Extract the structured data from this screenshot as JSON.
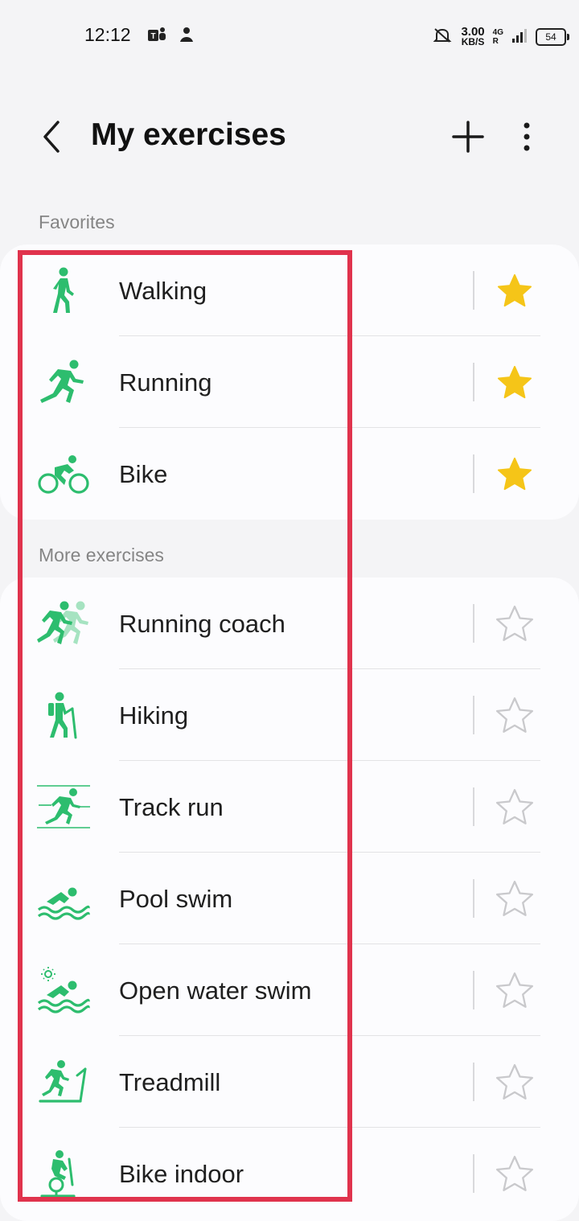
{
  "status_bar": {
    "time": "12:12",
    "net_speed_value": "3.00",
    "net_speed_unit": "KB/S",
    "net_type_1": "4G",
    "net_type_2": "R",
    "battery": "54"
  },
  "header": {
    "title": "My exercises",
    "back_icon": "chevron-left-icon",
    "add_icon": "plus-icon",
    "more_icon": "more-vertical-icon"
  },
  "favorites": {
    "label": "Favorites",
    "items": [
      {
        "label": "Walking",
        "icon": "walking-icon",
        "favorite": true
      },
      {
        "label": "Running",
        "icon": "running-icon",
        "favorite": true
      },
      {
        "label": "Bike",
        "icon": "bike-icon",
        "favorite": true
      }
    ]
  },
  "more_exercises": {
    "label": "More exercises",
    "items": [
      {
        "label": "Running coach",
        "icon": "running-coach-icon",
        "favorite": false
      },
      {
        "label": "Hiking",
        "icon": "hiking-icon",
        "favorite": false
      },
      {
        "label": "Track run",
        "icon": "track-run-icon",
        "favorite": false
      },
      {
        "label": "Pool swim",
        "icon": "pool-swim-icon",
        "favorite": false
      },
      {
        "label": "Open water swim",
        "icon": "open-water-swim-icon",
        "favorite": false
      },
      {
        "label": "Treadmill",
        "icon": "treadmill-icon",
        "favorite": false
      },
      {
        "label": "Bike indoor",
        "icon": "bike-indoor-icon",
        "favorite": false
      }
    ]
  },
  "colors": {
    "accent_green": "#2dbd6e",
    "star_filled": "#f5c518",
    "star_outline": "#c9c9cc",
    "highlight": "#e0334d"
  }
}
